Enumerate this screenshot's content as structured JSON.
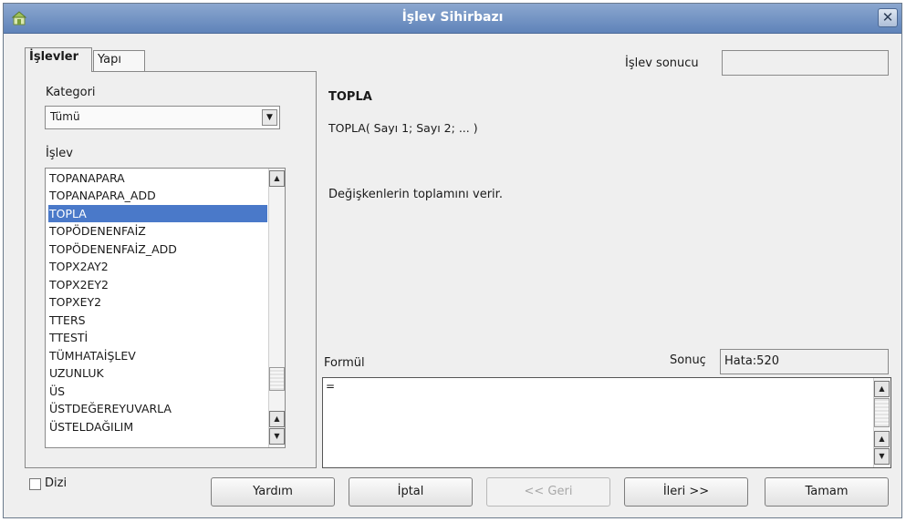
{
  "window": {
    "title": "İşlev Sihirbazı",
    "close_glyph": "✕"
  },
  "tabs": [
    {
      "label": "İşlevler",
      "active": true
    },
    {
      "label": "Yapı",
      "active": false
    }
  ],
  "category": {
    "label": "Kategori",
    "selected": "Tümü"
  },
  "function_list": {
    "label": "İşlev",
    "items": [
      "TOPANAPARA",
      "TOPANAPARA_ADD",
      "TOPLA",
      "TOPÖDENENFAİZ",
      "TOPÖDENENFAİZ_ADD",
      "TOPX2AY2",
      "TOPX2EY2",
      "TOPXEY2",
      "TTERS",
      "TTESTİ",
      "TÜMHATAİŞLEV",
      "UZUNLUK",
      "ÜS",
      "ÜSTDEĞEREYUVARLA",
      "ÜSTELDAĞILIM"
    ],
    "selected": "TOPLA"
  },
  "details": {
    "function_name": "TOPLA",
    "syntax": "TOPLA( Sayı 1; Sayı 2; ...  )",
    "description": "Değişkenlerin toplamını verir."
  },
  "function_result": {
    "label": "İşlev sonucu",
    "value": ""
  },
  "formula": {
    "label": "Formül",
    "value": "=",
    "result_label": "Sonuç",
    "result_value": "Hata:520"
  },
  "array_option": {
    "label": "Dizi",
    "checked": false
  },
  "buttons": {
    "help": "Yardım",
    "cancel": "İptal",
    "back": "<< Geri",
    "next": "İleri >>",
    "ok": "Tamam"
  }
}
